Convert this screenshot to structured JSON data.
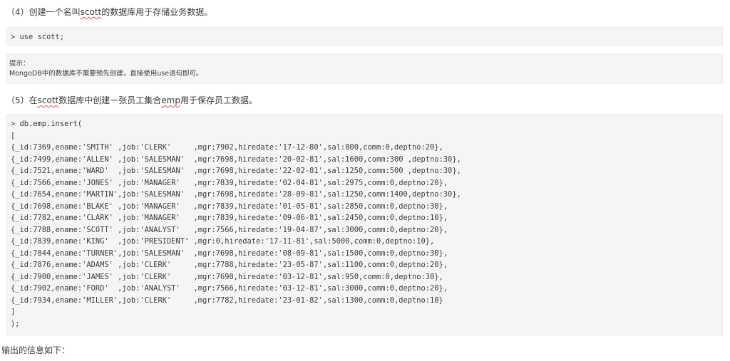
{
  "step4": {
    "prefix": "（4）创建一个名叫",
    "keyword": "scott",
    "suffix": "的数据库用于存储业务数据。"
  },
  "use_command": "> use scott;",
  "tip": {
    "title": "提示：",
    "text": "MongoDB中的数据库不需要预先创建，直接使用use语句即可。"
  },
  "step5": {
    "prefix": "（5）在",
    "keyword1": "scott",
    "middle": "数据库中创建一张员工集合",
    "keyword2": "emp",
    "suffix": "用于保存员工数据。"
  },
  "insert_code": [
    "> db.emp.insert(",
    "[",
    "{_id:7369,ename:'SMITH' ,job:'CLERK'     ,mgr:7902,hiredate:'17-12-80',sal:800,comm:0,deptno:20},",
    "{_id:7499,ename:'ALLEN' ,job:'SALESMAN'  ,mgr:7698,hiredate:'20-02-81',sal:1600,comm:300 ,deptno:30},",
    "{_id:7521,ename:'WARD'  ,job:'SALESMAN'  ,mgr:7698,hiredate:'22-02-81',sal:1250,comm:500 ,deptno:30},",
    "{_id:7566,ename:'JONES' ,job:'MANAGER'   ,mgr:7839,hiredate:'02-04-81',sal:2975,comm:0,deptno:20},",
    "{_id:7654,ename:'MARTIN',job:'SALESMAN'  ,mgr:7698,hiredate:'28-09-81',sal:1250,comm:1400,deptno:30},",
    "{_id:7698,ename:'BLAKE' ,job:'MANAGER'   ,mgr:7839,hiredate:'01-05-81',sal:2850,comm:0,deptno:30},",
    "{_id:7782,ename:'CLARK' ,job:'MANAGER'   ,mgr:7839,hiredate:'09-06-81',sal:2450,comm:0,deptno:10},",
    "{_id:7788,ename:'SCOTT' ,job:'ANALYST'   ,mgr:7566,hiredate:'19-04-87',sal:3000,comm:0,deptno:20},",
    "{_id:7839,ename:'KING'  ,job:'PRESIDENT' ,mgr:0,hiredate:'17-11-81',sal:5000,comm:0,deptno:10},",
    "{_id:7844,ename:'TURNER',job:'SALESMAN'  ,mgr:7698,hiredate:'08-09-81',sal:1500,comm:0,deptno:30},",
    "{_id:7876,ename:'ADAMS' ,job:'CLERK'     ,mgr:7788,hiredate:'23-05-87',sal:1100,comm:0,deptno:20},",
    "{_id:7900,ename:'JAMES' ,job:'CLERK'     ,mgr:7698,hiredate:'03-12-81',sal:950,comm:0,deptno:30},",
    "{_id:7902,ename:'FORD'  ,job:'ANALYST'   ,mgr:7566,hiredate:'03-12-81',sal:3000,comm:0,deptno:20},",
    "{_id:7934,ename:'MILLER',job:'CLERK'     ,mgr:7782,hiredate:'23-01-82',sal:1300,comm:0,deptno:10}",
    "]",
    ");"
  ],
  "output_label": "输出的信息如下："
}
